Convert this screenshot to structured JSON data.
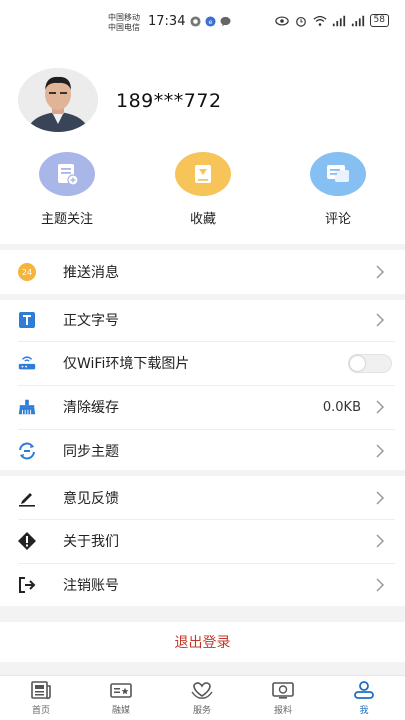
{
  "status_bar": {
    "carrier_1": "中国移动",
    "carrier_2": "中国电信",
    "time": "17:34",
    "battery": "58"
  },
  "profile": {
    "phone": "189***772"
  },
  "quick_actions": [
    {
      "label": "主题关注",
      "icon": "topic-follow-icon",
      "color": "#a9b6e8"
    },
    {
      "label": "收藏",
      "icon": "bookmark-icon",
      "color": "#f7c45a"
    },
    {
      "label": "评论",
      "icon": "comment-icon",
      "color": "#86bff2"
    }
  ],
  "settings": {
    "push": {
      "label": "推送消息",
      "icon": "push-badge-icon",
      "badge": "24"
    },
    "font_size": {
      "label": "正文字号",
      "icon": "text-size-icon"
    },
    "wifi_images": {
      "label": "仅WiFi环境下载图片",
      "icon": "router-icon",
      "enabled": false
    },
    "clear_cache": {
      "label": "清除缓存",
      "value": "0.0KB",
      "icon": "broom-icon"
    },
    "sync_topics": {
      "label": "同步主题",
      "icon": "sync-icon"
    },
    "feedback": {
      "label": "意见反馈",
      "icon": "pencil-icon"
    },
    "about": {
      "label": "关于我们",
      "icon": "warning-diamond-icon"
    },
    "deactivate": {
      "label": "注销账号",
      "icon": "exit-icon"
    }
  },
  "logout_label": "退出登录",
  "tabs": [
    {
      "label": "首页",
      "icon": "newspaper-icon"
    },
    {
      "label": "融媒",
      "icon": "media-icon"
    },
    {
      "label": "服务",
      "icon": "heart-hands-icon"
    },
    {
      "label": "报料",
      "icon": "report-icon"
    },
    {
      "label": "我",
      "icon": "user-icon",
      "active": true
    }
  ],
  "colors": {
    "accent": "#1e6fc0",
    "logout": "#c0392b",
    "section_gap": "#f3f3f3"
  }
}
